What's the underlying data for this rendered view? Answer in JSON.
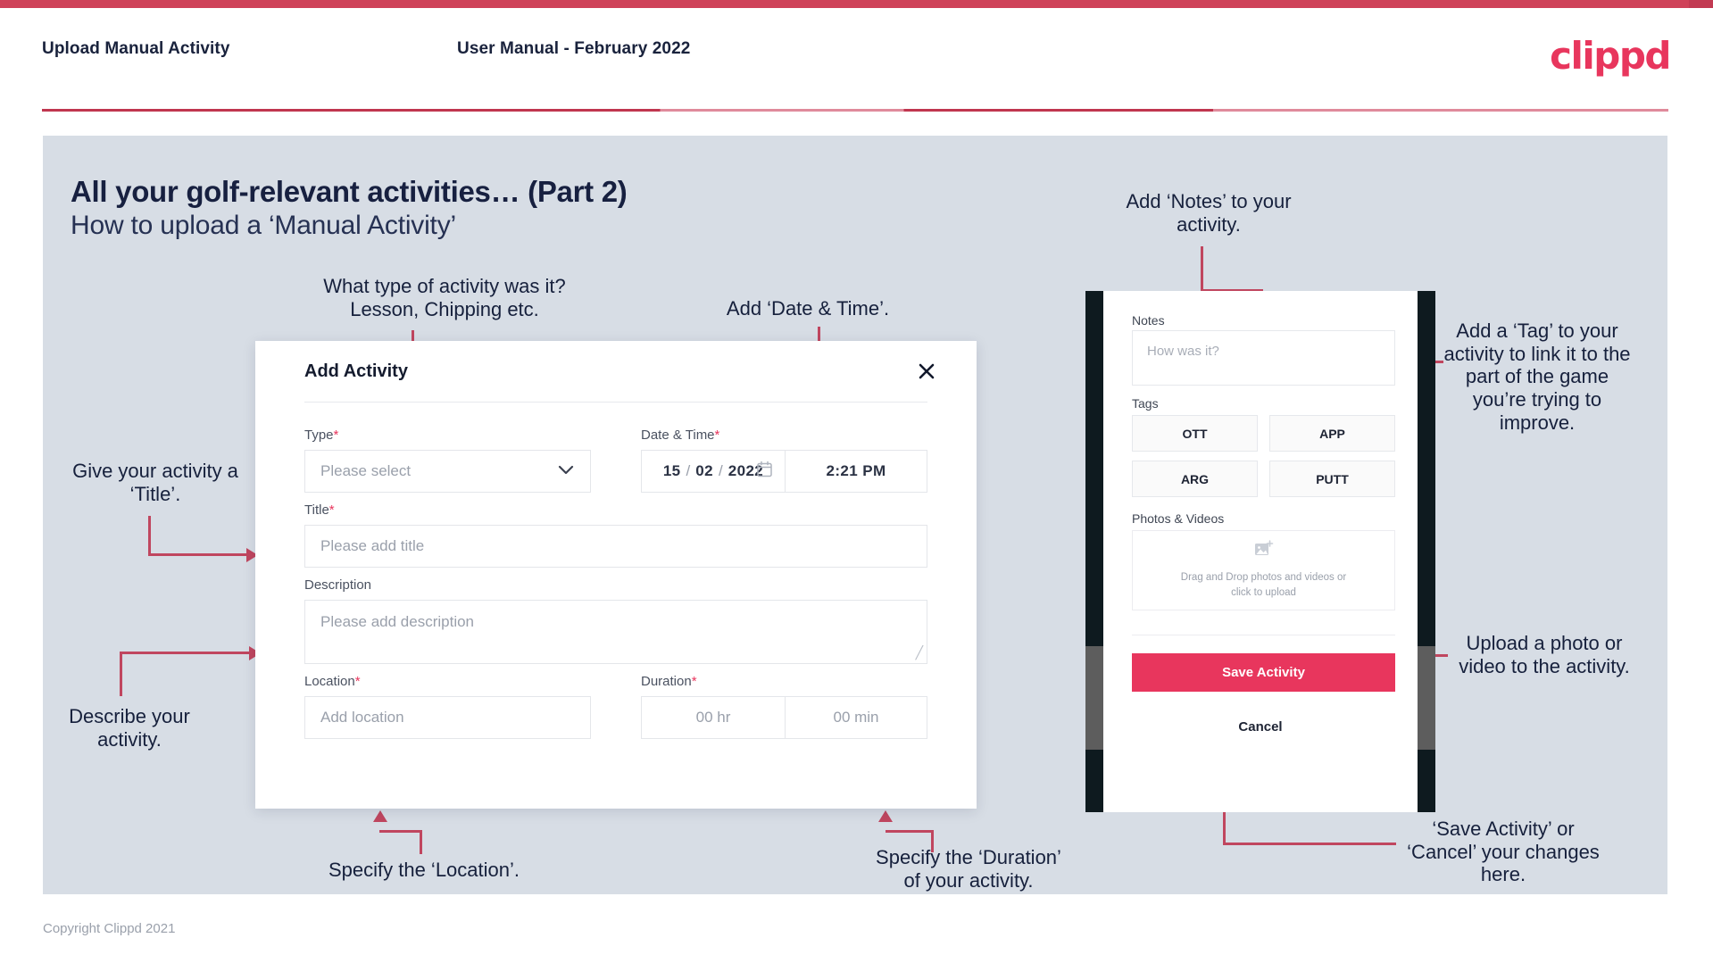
{
  "header": {
    "left_title": "Upload Manual Activity",
    "center_title": "User Manual - February 2022",
    "logo": "clippd"
  },
  "slide": {
    "heading": "All your golf-relevant activities… (Part 2)",
    "subheading": "How to upload a ‘Manual Activity’"
  },
  "annotations": {
    "type": "What type of activity was it?\nLesson, Chipping etc.",
    "type_line1": "What type of activity was it?",
    "type_line2": "Lesson, Chipping etc.",
    "date_time": "Add ‘Date & Time’.",
    "title": "Give your activity a\n‘Title’.",
    "title_line1": "Give your activity a",
    "title_line2": "‘Title’.",
    "description_line1": "Describe your",
    "description_line2": "activity.",
    "location": "Specify the ‘Location’.",
    "duration_line1": "Specify the ‘Duration’",
    "duration_line2": "of your activity.",
    "notes_line1": "Add ‘Notes’ to your",
    "notes_line2": "activity.",
    "tags": "Add a ‘Tag’ to your activity to link it to the part of the game you’re trying to improve.",
    "upload_line1": "Upload a photo or",
    "upload_line2": "video to the activity.",
    "save_line1": "‘Save Activity’ or",
    "save_line2": "‘Cancel’ your changes",
    "save_line3": "here."
  },
  "dialog": {
    "title": "Add Activity",
    "close_icon": "close-icon",
    "fields": {
      "type": {
        "label": "Type",
        "required": "*",
        "placeholder": "Please select",
        "chevron_icon": "chevron-down-icon"
      },
      "datetime": {
        "label": "Date & Time",
        "required": "*",
        "day": "15",
        "month": "02",
        "year": "2022",
        "sep": "/",
        "time": "2:21 PM",
        "calendar_icon": "calendar-icon"
      },
      "title": {
        "label": "Title",
        "required": "*",
        "placeholder": "Please add title"
      },
      "description": {
        "label": "Description",
        "placeholder": "Please add description"
      },
      "location": {
        "label": "Location",
        "required": "*",
        "placeholder": "Add location"
      },
      "duration": {
        "label": "Duration",
        "required": "*",
        "hours_placeholder": "00 hr",
        "minutes_placeholder": "00 min"
      }
    }
  },
  "phone": {
    "notes": {
      "label": "Notes",
      "placeholder": "How was it?"
    },
    "tags": {
      "label": "Tags",
      "items": [
        "OTT",
        "APP",
        "ARG",
        "PUTT"
      ]
    },
    "photos": {
      "label": "Photos & Videos",
      "dropzone_line1": "Drag and Drop photos and videos or",
      "dropzone_line2": "click to upload",
      "icon": "add-image-icon"
    },
    "save_label": "Save Activity",
    "cancel_label": "Cancel"
  },
  "footer": {
    "copyright": "Copyright Clippd 2021"
  },
  "colors": {
    "accent": "#cf4259",
    "brand_pink": "#e8365d",
    "slide_bg": "#d7dde5",
    "text_dark": "#16203c",
    "connector": "#c0465f"
  }
}
